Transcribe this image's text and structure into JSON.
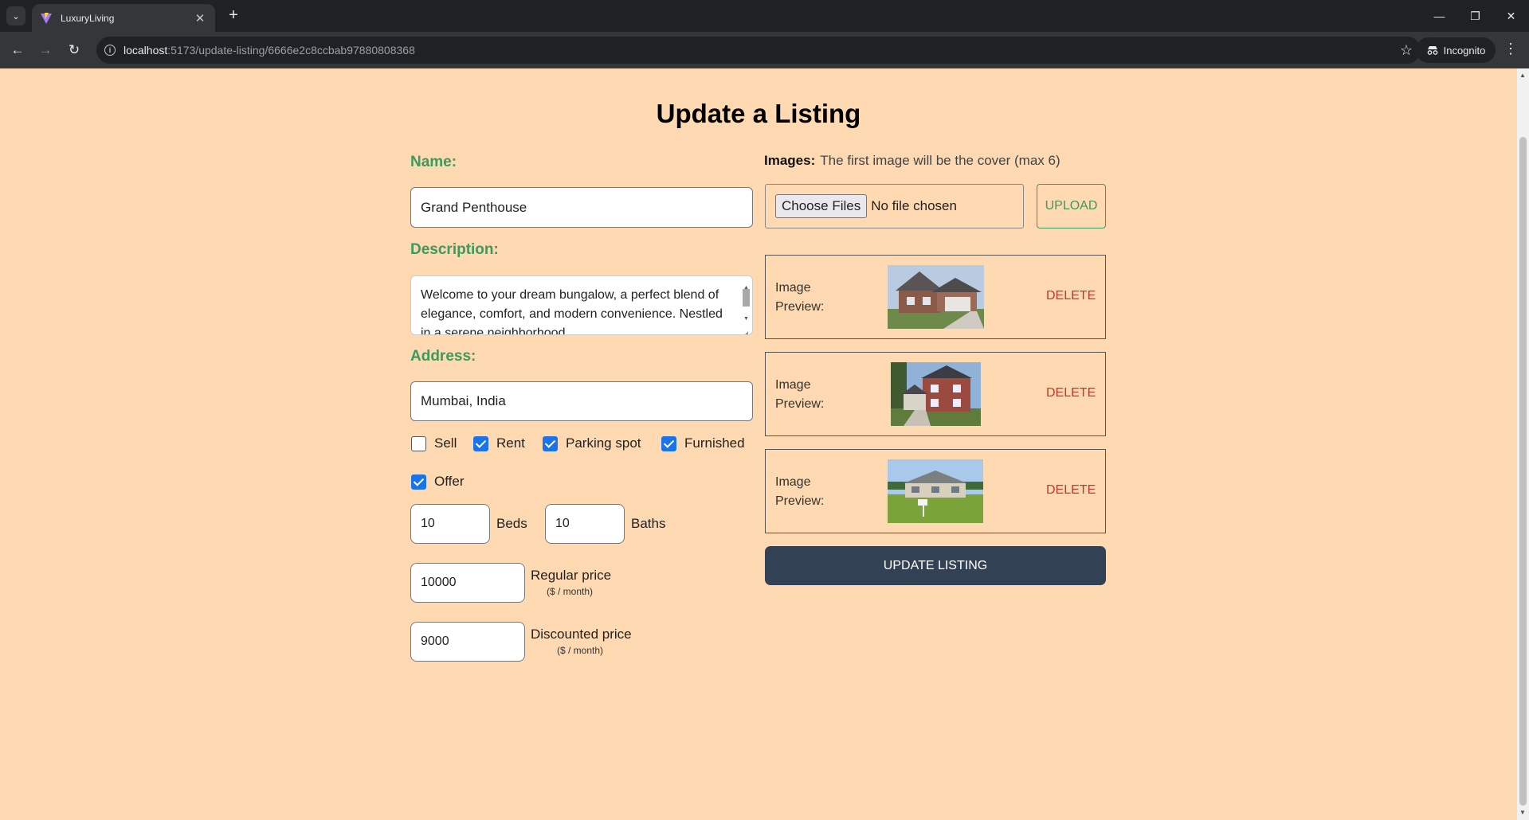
{
  "browser": {
    "tab_title": "LuxuryLiving",
    "url_host": "localhost",
    "url_path": ":5173/update-listing/6666e2c8ccbab97880808368",
    "profile_label": "Incognito"
  },
  "page": {
    "title": "Update a Listing",
    "name_label": "Name:",
    "name_value": "Grand Penthouse",
    "description_label": "Description:",
    "description_value": "Welcome to your dream bungalow, a perfect blend of elegance, comfort, and modern convenience. Nestled in a serene neighborhood",
    "address_label": "Address:",
    "address_value": "Mumbai, India",
    "checkboxes": [
      {
        "label": "Sell",
        "checked": false
      },
      {
        "label": "Rent",
        "checked": true
      },
      {
        "label": "Parking spot",
        "checked": true
      },
      {
        "label": "Furnished",
        "checked": true
      },
      {
        "label": "Offer",
        "checked": true
      }
    ],
    "beds_value": "10",
    "beds_label": "Beds",
    "baths_value": "10",
    "baths_label": "Baths",
    "regular_price_value": "10000",
    "regular_price_label": "Regular price",
    "regular_price_unit": "($ / month)",
    "discounted_price_value": "9000",
    "discounted_price_label": "Discounted price",
    "discounted_price_unit": "($ / month)",
    "images_label": "Images:",
    "images_hint": "The first image will be the cover (max 6)",
    "choose_files_label": "Choose Files",
    "no_file_label": "No file chosen",
    "upload_label": "UPLOAD",
    "previews": [
      {
        "label_line1": "Image",
        "label_line2": "Preview:",
        "delete_label": "DELETE"
      },
      {
        "label_line1": "Image",
        "label_line2": "Preview:",
        "delete_label": "DELETE"
      },
      {
        "label_line1": "Image",
        "label_line2": "Preview:",
        "delete_label": "DELETE"
      }
    ],
    "update_button_label": "UPDATE LISTING"
  },
  "colors": {
    "page_background": "#fed9b1",
    "label_green": "#3b9a5e",
    "delete_red": "#c0392b",
    "button_dark": "#334155",
    "checkbox_blue": "#1a73e8"
  }
}
